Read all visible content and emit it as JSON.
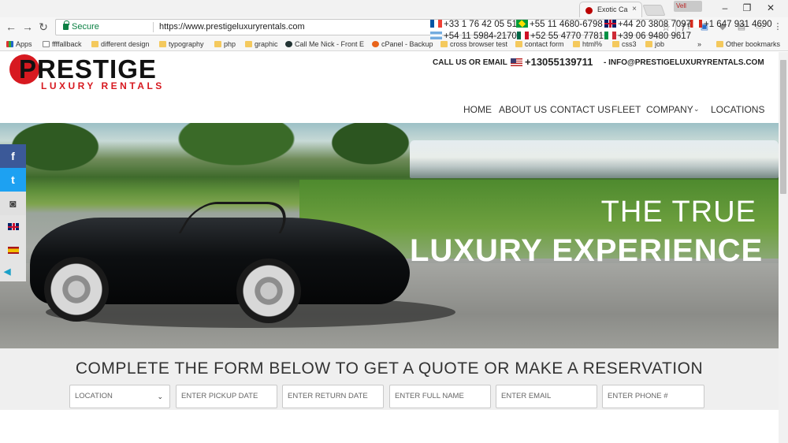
{
  "browser": {
    "tab_title": "Exotic Ca",
    "tab_close": "×",
    "profile_badge": "Vell",
    "win_minimize": "–",
    "win_restore": "❐",
    "win_close": "✕",
    "secure_label": "Secure",
    "url": "https://www.prestigeluxuryrentals.com",
    "icons": {
      "back": "←",
      "forward": "→",
      "reload": "↻",
      "star": "☆",
      "ext1": "ƒ?",
      "ext2": "▣",
      "ext3": "◆",
      "ext4": "▤",
      "ext5": "▭",
      "menu": "⋮"
    }
  },
  "bookmarks": [
    {
      "label": "Apps",
      "type": "apps"
    },
    {
      "label": "ffffallback",
      "type": "page"
    },
    {
      "label": "different design",
      "type": "folder"
    },
    {
      "label": "typography",
      "type": "folder"
    },
    {
      "label": "php",
      "type": "folder"
    },
    {
      "label": "graphic",
      "type": "folder"
    },
    {
      "label": "Call Me Nick - Front E",
      "type": "nick"
    },
    {
      "label": "cPanel - Backup",
      "type": "cpanel"
    },
    {
      "label": "cross browser test",
      "type": "folder"
    },
    {
      "label": "contact form",
      "type": "folder"
    },
    {
      "label": "html%",
      "type": "folder"
    },
    {
      "label": "css3",
      "type": "folder"
    },
    {
      "label": "job",
      "type": "folder"
    }
  ],
  "bookmarks_more": "»",
  "other_bookmarks": "Other bookmarks",
  "site": {
    "logo_word": "PRESTIGE",
    "logo_sub": "LUXURY RENTALS",
    "call_label": "CALL US OR EMAIL",
    "main_phone": "+13055139711",
    "email": "- INFO@PRESTIGELUXURYRENTALS.COM",
    "phones_row1": [
      {
        "flag": "fr",
        "number": "+33 1 76 42 05 51"
      },
      {
        "flag": "br",
        "number": "+55 11 4680-6798"
      },
      {
        "flag": "uk",
        "number": "+44 20 3808 7097"
      },
      {
        "flag": "ca",
        "number": "+1 647 931 4690"
      }
    ],
    "phones_row2": [
      {
        "flag": "ar",
        "number": "+54 11 5984-2170"
      },
      {
        "flag": "mx",
        "number": "+52 55 4770 7781"
      },
      {
        "flag": "it",
        "number": "+39 06 9480 9617"
      }
    ],
    "nav": [
      "HOME",
      "ABOUT US",
      "CONTACT US",
      "FLEET",
      "COMPANY",
      "LOCATIONS"
    ],
    "nav_caret": "⌄"
  },
  "hero": {
    "line1": "THE TRUE",
    "line2": "LUXURY EXPERIENCE"
  },
  "social": {
    "facebook": "f",
    "twitter": "t",
    "instagram": "◙",
    "collapse": "◀"
  },
  "form": {
    "heading": "COMPLETE THE FORM BELOW TO GET A QUOTE OR MAKE A RESERVATION",
    "location": "LOCATION",
    "location_caret": "⌄",
    "pickup": "ENTER PICKUP DATE",
    "return": "ENTER RETURN DATE",
    "full_name": "ENTER FULL NAME",
    "email": "ENTER EMAIL",
    "phone": "ENTER PHONE #"
  },
  "colors": {
    "brand_red": "#d71920",
    "secure_green": "#0b8043",
    "facebook": "#3b5998",
    "twitter": "#1da1f2"
  }
}
